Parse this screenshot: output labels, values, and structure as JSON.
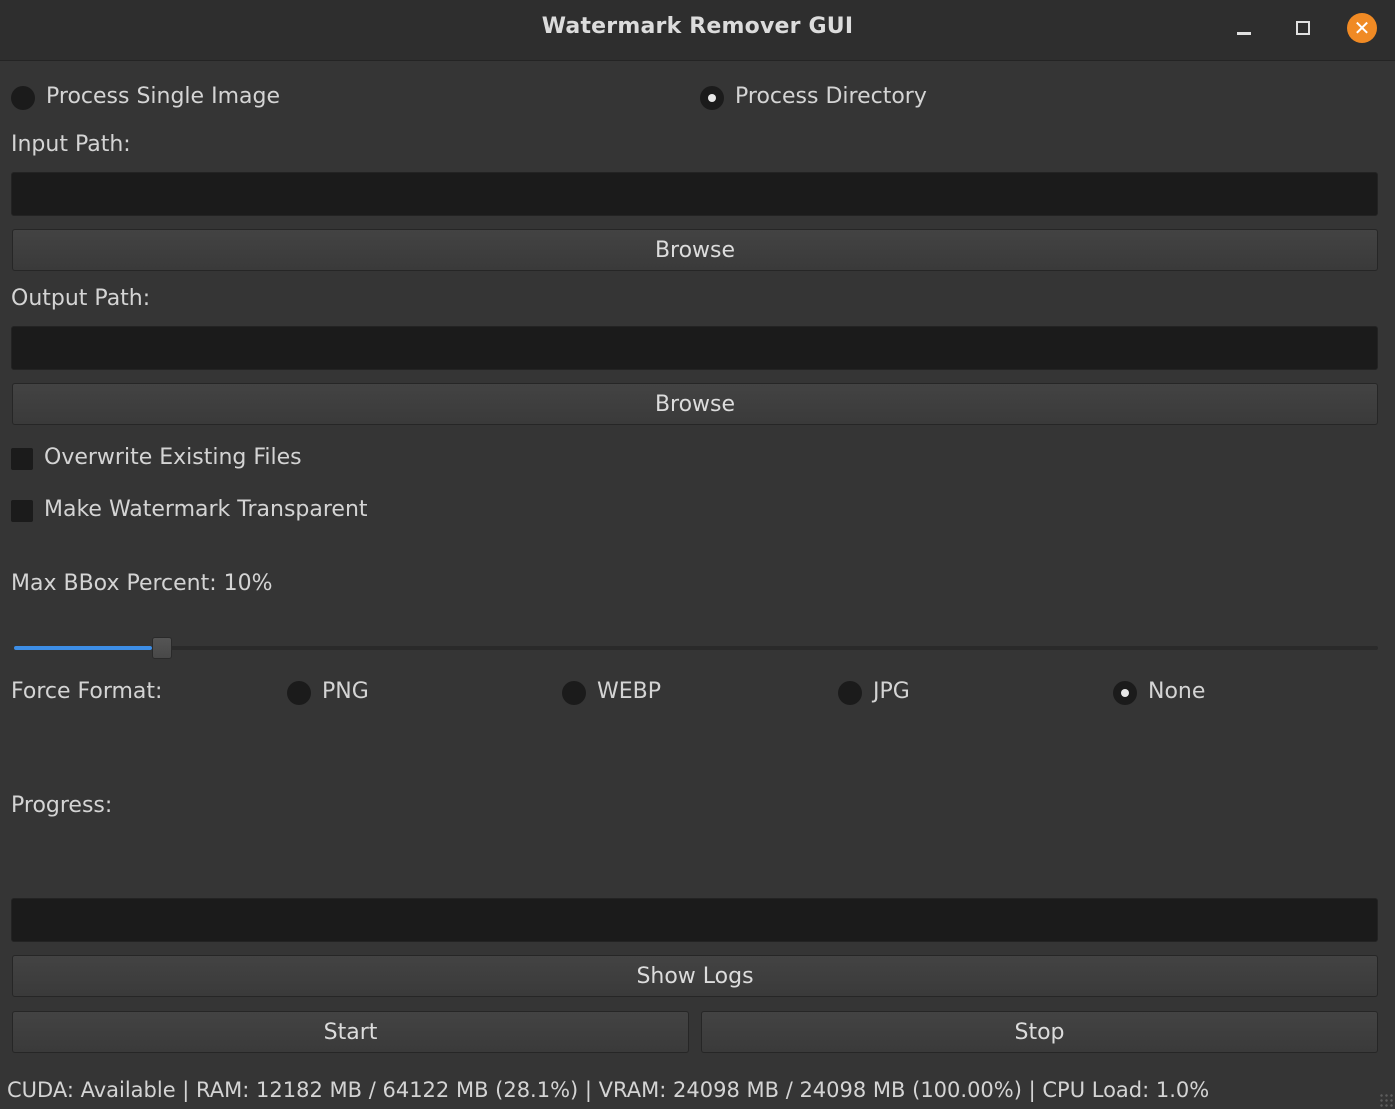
{
  "window": {
    "title": "Watermark Remover GUI"
  },
  "mode": {
    "options": [
      {
        "label": "Process Single Image",
        "checked": false
      },
      {
        "label": "Process Directory",
        "checked": true
      }
    ]
  },
  "input": {
    "label": "Input Path:",
    "value": "",
    "browse_label": "Browse"
  },
  "output": {
    "label": "Output Path:",
    "value": "",
    "browse_label": "Browse"
  },
  "options": {
    "overwrite_label": "Overwrite Existing Files",
    "overwrite_checked": false,
    "transparent_label": "Make Watermark Transparent",
    "transparent_checked": false
  },
  "bbox": {
    "label": "Max BBox Percent: 10%",
    "value_fraction": 0.1
  },
  "format": {
    "label": "Force Format:",
    "options": [
      {
        "label": "PNG",
        "checked": false
      },
      {
        "label": "WEBP",
        "checked": false
      },
      {
        "label": "JPG",
        "checked": false
      },
      {
        "label": "None",
        "checked": true
      }
    ]
  },
  "progress": {
    "label": "Progress:",
    "fraction": 0
  },
  "actions": {
    "show_logs_label": "Show Logs",
    "start_label": "Start",
    "stop_label": "Stop"
  },
  "status": {
    "text": "CUDA: Available | RAM: 12182 MB / 64122 MB (28.1%) | VRAM: 24098 MB / 24098 MB (100.00%) | CPU Load: 1.0%"
  },
  "colors": {
    "accent": "#3d8ee6",
    "close_button": "#f08a24",
    "background": "#353535",
    "field_background": "#1b1b1b"
  }
}
